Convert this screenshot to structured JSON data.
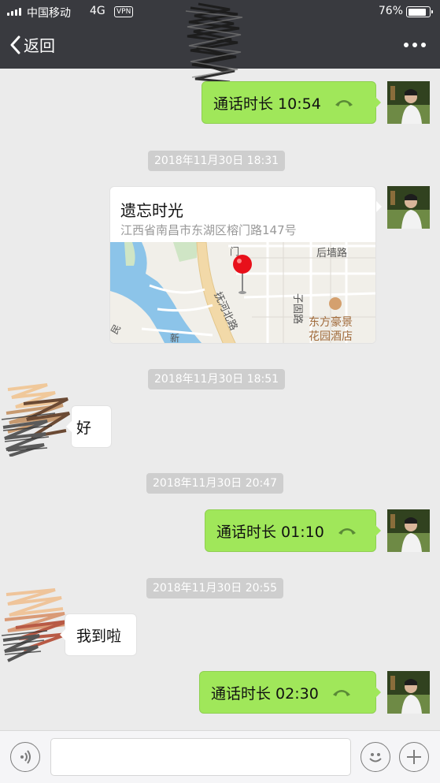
{
  "status_bar": {
    "carrier": "中国移动",
    "network": "4G",
    "vpn": "VPN",
    "battery": "76%"
  },
  "nav": {
    "back_label": "返回"
  },
  "messages": [
    {
      "call_label": "通话时长 10:54"
    },
    {
      "timestamp": "2018年11月30日 18:31"
    },
    {
      "location_title": "遗忘时光",
      "location_address": "江西省南昌市东湖区榕门路147号",
      "map_labels": [
        "后墙路",
        "子固路",
        "抚河北路",
        "东方豪景",
        "花园酒店",
        "新",
        "门",
        "民"
      ]
    },
    {
      "timestamp": "2018年11月30日 18:51"
    },
    {
      "text": "好"
    },
    {
      "timestamp": "2018年11月30日 20:47"
    },
    {
      "call_label": "通话时长 01:10"
    },
    {
      "timestamp": "2018年11月30日 20:55"
    },
    {
      "text": "我到啦"
    },
    {
      "call_label": "通话时长 02:30"
    }
  ],
  "colors": {
    "nav_bg": "#393a3f",
    "chat_bg": "#ebebeb",
    "my_bubble": "#a0e75a",
    "timestamp_bg": "#cecece"
  }
}
